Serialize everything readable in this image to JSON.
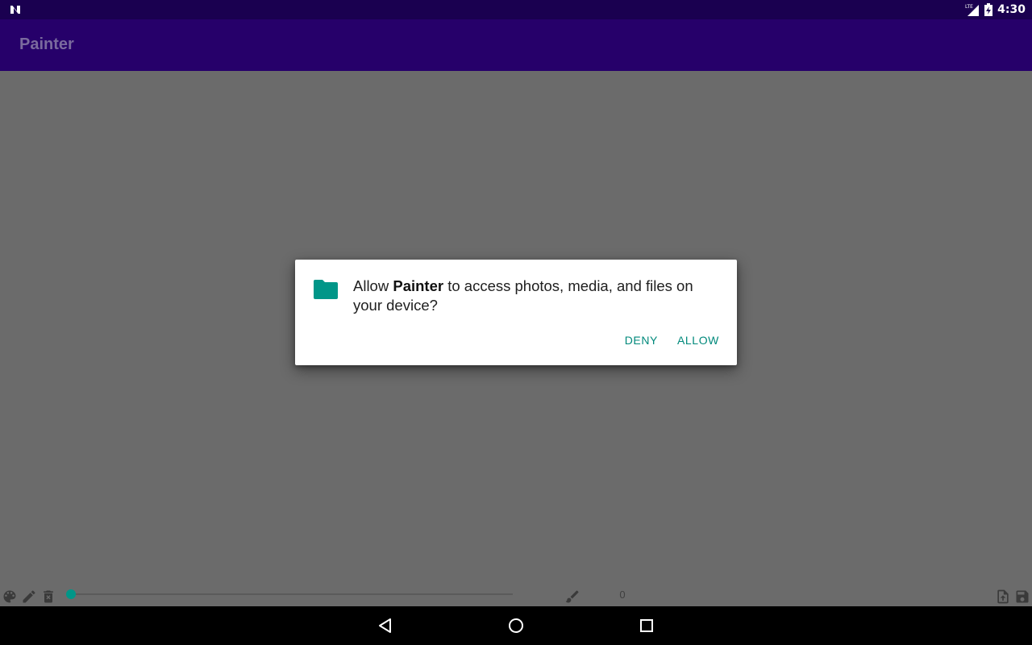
{
  "status_bar": {
    "time": "4:30",
    "network_label": "LTE",
    "icons": [
      "notification-n-icon",
      "signal-icon",
      "battery-icon"
    ]
  },
  "app_bar": {
    "title": "Painter",
    "background": "#26006a"
  },
  "permission_dialog": {
    "icon": "folder-icon",
    "message_prefix": "Allow ",
    "app_name": "Painter",
    "message_suffix": " to access photos, media, and files on your device?",
    "deny_label": "DENY",
    "allow_label": "ALLOW",
    "accent_color": "#009688"
  },
  "toolbar": {
    "left_icons": [
      "palette-icon",
      "pencil-icon",
      "trash-icon"
    ],
    "brush_size_slider": {
      "value": 0
    },
    "brush_size_value": "0",
    "brush_icon": "brush-icon",
    "right_icons": [
      "file-upload-icon",
      "save-icon"
    ]
  },
  "nav_bar": {
    "buttons": [
      "back-icon",
      "home-icon",
      "recents-icon"
    ]
  }
}
